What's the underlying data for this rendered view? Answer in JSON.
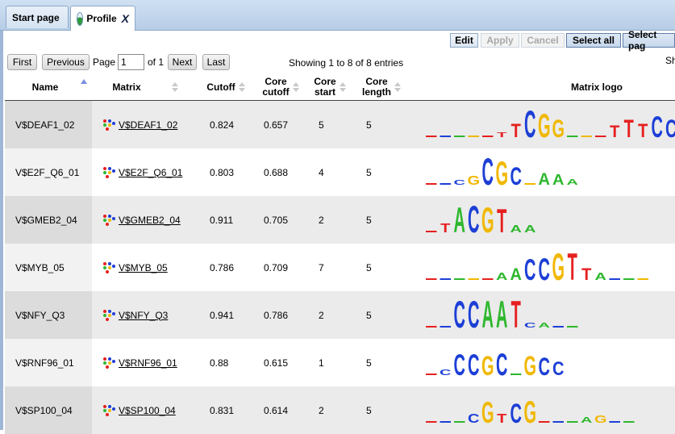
{
  "tabs": [
    {
      "label": "Start page",
      "active": false
    },
    {
      "label": "Profile",
      "active": true,
      "close": "X"
    }
  ],
  "toolbar": {
    "edit": "Edit",
    "apply": "Apply",
    "cancel": "Cancel",
    "select_all": "Select all",
    "select_page": "Select pag"
  },
  "pager": {
    "first": "First",
    "previous": "Previous",
    "page_label": "Page",
    "page_value": "1",
    "of_label": "of 1",
    "next": "Next",
    "last": "Last",
    "showing": "Showing 1 to 8 of 8 entries",
    "sh": "Sh"
  },
  "columns": {
    "name": "Name",
    "matrix": "Matrix",
    "cutoff": "Cutoff",
    "core_cutoff_1": "Core",
    "core_cutoff_2": "cutoff",
    "core_start_1": "Core",
    "core_start_2": "start",
    "core_length_1": "Core",
    "core_length_2": "length",
    "logo": "Matrix logo"
  },
  "colors": {
    "A": "#2eb82e",
    "C": "#1d3fd6",
    "G": "#f0b800",
    "T": "#e62020",
    "tab_bg": "#c8dbef"
  },
  "rows": [
    {
      "name": "V$DEAF1_02",
      "matrix": "V$DEAF1_02",
      "cutoff": "0.824",
      "core_cutoff": "0.657",
      "core_start": "5",
      "core_length": "5",
      "logo": [
        [
          "",
          0
        ],
        [
          "",
          0
        ],
        [
          "",
          0
        ],
        [
          "",
          0
        ],
        [
          "",
          0
        ],
        [
          "T",
          0.3
        ],
        [
          "T",
          0.9
        ],
        [
          "C",
          1.8
        ],
        [
          "G",
          1.6
        ],
        [
          "G",
          1.2
        ],
        [
          "",
          0
        ],
        [
          "",
          0
        ],
        [
          "",
          0
        ],
        [
          "T",
          0.8
        ],
        [
          "T",
          1.2
        ],
        [
          "T",
          0.9
        ],
        [
          "C",
          1.4
        ],
        [
          "C",
          1.2
        ]
      ]
    },
    {
      "name": "V$E2F_Q6_01",
      "matrix": "V$E2F_Q6_01",
      "cutoff": "0.803",
      "core_cutoff": "0.688",
      "core_start": "4",
      "core_length": "5",
      "logo": [
        [
          "",
          0
        ],
        [
          "",
          0
        ],
        [
          "C",
          0.3
        ],
        [
          "G",
          0.6
        ],
        [
          "C",
          1.8
        ],
        [
          "G",
          1.6
        ],
        [
          "C",
          1.2
        ],
        [
          "",
          0
        ],
        [
          "A",
          0.8
        ],
        [
          "A",
          0.7
        ],
        [
          "A",
          0.4
        ]
      ]
    },
    {
      "name": "V$GMEB2_04",
      "matrix": "V$GMEB2_04",
      "cutoff": "0.911",
      "core_cutoff": "0.705",
      "core_start": "2",
      "core_length": "5",
      "logo": [
        [
          "",
          0
        ],
        [
          "T",
          0.6
        ],
        [
          "A",
          1.7
        ],
        [
          "C",
          1.8
        ],
        [
          "G",
          1.7
        ],
        [
          "T",
          1.6
        ],
        [
          "A",
          0.5
        ],
        [
          "A",
          0.5
        ]
      ]
    },
    {
      "name": "V$MYB_05",
      "matrix": "V$MYB_05",
      "cutoff": "0.786",
      "core_cutoff": "0.709",
      "core_start": "7",
      "core_length": "5",
      "logo": [
        [
          "",
          0
        ],
        [
          "",
          0
        ],
        [
          "",
          0
        ],
        [
          "",
          0
        ],
        [
          "",
          0
        ],
        [
          "A",
          0.5
        ],
        [
          "A",
          0.8
        ],
        [
          "C",
          1.4
        ],
        [
          "C",
          1.5
        ],
        [
          "G",
          1.8
        ],
        [
          "T",
          1.8
        ],
        [
          "T",
          0.8
        ],
        [
          "A",
          0.5
        ],
        [
          "",
          0
        ],
        [
          "",
          0
        ],
        [
          "",
          0
        ]
      ]
    },
    {
      "name": "V$NFY_Q3",
      "matrix": "V$NFY_Q3",
      "cutoff": "0.941",
      "core_cutoff": "0.786",
      "core_start": "2",
      "core_length": "5",
      "logo": [
        [
          "",
          0
        ],
        [
          "",
          0
        ],
        [
          "C",
          1.8
        ],
        [
          "C",
          1.8
        ],
        [
          "A",
          1.8
        ],
        [
          "A",
          1.8
        ],
        [
          "T",
          1.8
        ],
        [
          "C",
          0.3
        ],
        [
          "A",
          0.3
        ],
        [
          "",
          0
        ],
        [
          "",
          0
        ]
      ]
    },
    {
      "name": "V$RNF96_01",
      "matrix": "V$RNF96_01",
      "cutoff": "0.88",
      "core_cutoff": "0.615",
      "core_start": "1",
      "core_length": "5",
      "logo": [
        [
          "",
          0
        ],
        [
          "C",
          0.4
        ],
        [
          "C",
          1.4
        ],
        [
          "C",
          1.4
        ],
        [
          "G",
          1.3
        ],
        [
          "C",
          1.5
        ],
        [
          "",
          0
        ],
        [
          "G",
          1.3
        ],
        [
          "C",
          1.2
        ],
        [
          "C",
          0.9
        ]
      ]
    },
    {
      "name": "V$SP100_04",
      "matrix": "V$SP100_04",
      "cutoff": "0.831",
      "core_cutoff": "0.614",
      "core_start": "2",
      "core_length": "5",
      "logo": [
        [
          "",
          0
        ],
        [
          "",
          0
        ],
        [
          "",
          0
        ],
        [
          "C",
          0.6
        ],
        [
          "G",
          1.4
        ],
        [
          "T",
          0.6
        ],
        [
          "C",
          1.3
        ],
        [
          "G",
          1.5
        ],
        [
          "",
          0
        ],
        [
          "",
          0
        ],
        [
          "",
          0
        ],
        [
          "A",
          0.4
        ],
        [
          "G",
          0.5
        ],
        [
          "",
          0
        ],
        [
          "",
          0
        ]
      ]
    }
  ]
}
